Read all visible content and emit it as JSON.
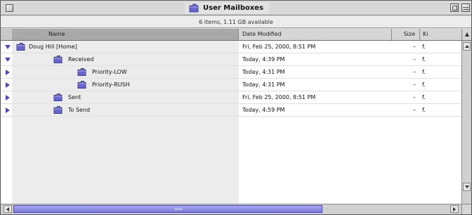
{
  "window": {
    "title": "User Mailboxes",
    "info_bar": "6 items, 1.11 GB available"
  },
  "columns": {
    "name": "Name",
    "date_modified": "Date Modified",
    "size": "Size",
    "kind": "Ki",
    "sort_indicator": "▲"
  },
  "rows": [
    {
      "name": "Doug Hill [Home]",
      "date": "Fri, Feb 25, 2000, 8:51 PM",
      "size": "–",
      "kind": "f.",
      "disclosure": "open",
      "indent": 0
    },
    {
      "name": "Received",
      "date": "Today, 4:39 PM",
      "size": "–",
      "kind": "f.",
      "disclosure": "open",
      "indent": 1
    },
    {
      "name": "Priority-LOW",
      "date": "Today, 4:31 PM",
      "size": "–",
      "kind": "f.",
      "disclosure": "closed",
      "indent": 2
    },
    {
      "name": "Priority-RUSH",
      "date": "Today, 4:31 PM",
      "size": "–",
      "kind": "f.",
      "disclosure": "closed",
      "indent": 2
    },
    {
      "name": "Sent",
      "date": "Fri, Feb 25, 2000, 8:51 PM",
      "size": "–",
      "kind": "f.",
      "disclosure": "closed",
      "indent": 1
    },
    {
      "name": "To Send",
      "date": "Today, 4:59 PM",
      "size": "–",
      "kind": "f.",
      "disclosure": "closed",
      "indent": 1
    }
  ],
  "icons": {
    "title": "folder-icon",
    "row": "folder-icon"
  },
  "colors": {
    "folder": "#6666cc",
    "disclosure": "#4a4ab4",
    "scroll_thumb": "#7a7ad8"
  }
}
